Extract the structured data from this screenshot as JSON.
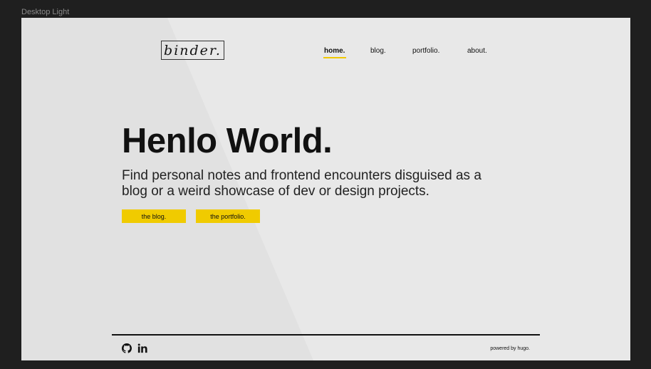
{
  "canvas": {
    "frame_label": "Desktop Light"
  },
  "brand": {
    "logo_text": "binder."
  },
  "nav": {
    "items": [
      {
        "label": "home.",
        "active": true
      },
      {
        "label": "blog.",
        "active": false
      },
      {
        "label": "portfolio.",
        "active": false
      },
      {
        "label": "about.",
        "active": false
      }
    ]
  },
  "hero": {
    "title": "Henlo World.",
    "subtitle": "Find personal notes and frontend encounters disguised as a blog or a weird showcase of dev or design projects.",
    "buttons": [
      {
        "label": "the blog."
      },
      {
        "label": "the portfolio."
      }
    ]
  },
  "footer": {
    "social_icons": [
      "github-icon",
      "linkedin-icon"
    ],
    "powered_by": "powered by hugo."
  },
  "colors": {
    "accent": "#f0cb00",
    "background": "#e8e8e8",
    "text": "#111111",
    "canvas": "#1f1f1f"
  }
}
